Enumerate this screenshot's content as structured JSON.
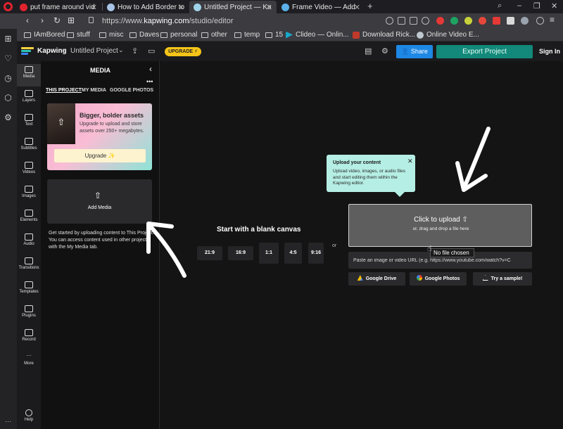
{
  "browser": {
    "tabs": [
      {
        "title": "put frame around vid"
      },
      {
        "title": "How to Add Border to"
      },
      {
        "title": "Untitled Project — Ka"
      },
      {
        "title": "Frame Video — Add"
      }
    ],
    "new_tab": "+",
    "window_controls": {
      "search": "⌕",
      "minimize": "–",
      "restore": "❐",
      "close": "✕"
    },
    "nav": {
      "back": "‹",
      "forward": "›",
      "reload": "↻",
      "speed_dial": "⊞"
    },
    "url": {
      "prefix": "https://www.",
      "domain": "kapwing.com",
      "path": "/studio/editor"
    },
    "bookmarks": [
      {
        "label": "IAmBored"
      },
      {
        "label": "stuff"
      },
      {
        "label": "misc"
      },
      {
        "label": "Daves"
      },
      {
        "label": "personal"
      },
      {
        "label": "other"
      },
      {
        "label": "temp"
      },
      {
        "label": "15"
      },
      {
        "label": "Clideo — Onlin..."
      },
      {
        "label": "Download Rick..."
      },
      {
        "label": "Online Video E..."
      }
    ],
    "sidebar_more": "···"
  },
  "app": {
    "brand": "Kapwing",
    "breadcrumb_sep": "›",
    "project_title": "Untitled Project",
    "project_dropdown": "⌄",
    "upgrade_label": "UPGRADE ⚡",
    "share_label": "Share",
    "export_label": "Export Project",
    "signin_label": "Sign In"
  },
  "rail": {
    "items": [
      {
        "label": "Media"
      },
      {
        "label": "Layers"
      },
      {
        "label": "Text"
      },
      {
        "label": "Subtitles"
      },
      {
        "label": "Videos"
      },
      {
        "label": "Images"
      },
      {
        "label": "Elements"
      },
      {
        "label": "Audio"
      },
      {
        "label": "Transitions"
      },
      {
        "label": "Templates"
      },
      {
        "label": "Plugins"
      },
      {
        "label": "Record"
      },
      {
        "label": "More"
      }
    ],
    "help_label": "Help"
  },
  "media_panel": {
    "title": "MEDIA",
    "collapse": "‹",
    "more": "•••",
    "tabs": [
      {
        "label": "THIS PROJECT"
      },
      {
        "label": "MY MEDIA"
      },
      {
        "label": "GOOGLE PHOTOS"
      }
    ],
    "promo": {
      "title": "Bigger, bolder assets",
      "description": "Upgrade to upload and store assets over 250+ megabytes.",
      "button": "Upgrade ✨"
    },
    "add_media": {
      "icon": "⇧",
      "label": "Add Media"
    },
    "info": "Get started by uploading content to This Project. You can access content used in other projects with the My Media tab."
  },
  "canvas": {
    "blank_title": "Start with a blank canvas",
    "ratios": [
      {
        "label": "21:9"
      },
      {
        "label": "16:9"
      },
      {
        "label": "1:1"
      },
      {
        "label": "4:5"
      },
      {
        "label": "9:16"
      }
    ],
    "or_label": "or",
    "tooltip": {
      "title": "Upload your content",
      "close": "✕",
      "description": "Upload video, images, or audio files and start editing them within the Kapwing editor."
    },
    "upload": {
      "title": "Click to upload",
      "subtitle": "or, drag and drop a file here",
      "no_file": "No file chosen"
    },
    "url_placeholder": "Paste an image or video URL (e.g. https://www.youtube.com/watch?v=C",
    "sources": [
      {
        "label": "Google Drive"
      },
      {
        "label": "Google Photos"
      },
      {
        "label": "Try a sample!"
      }
    ]
  },
  "colors": {
    "accent_blue": "#1e88e5",
    "export_teal": "#12897a",
    "upgrade_yellow": "#f5c518",
    "tooltip_mint": "#b5eee4"
  }
}
